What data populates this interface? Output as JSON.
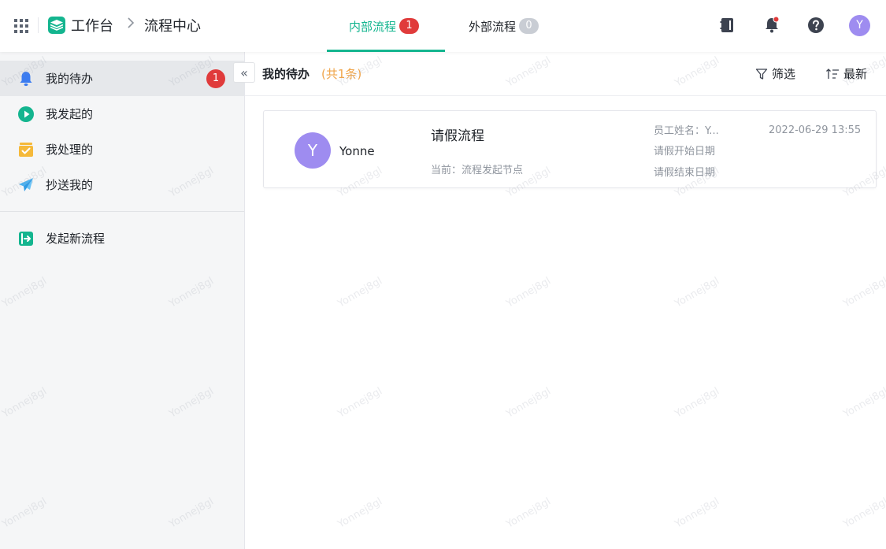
{
  "header": {
    "brand": "工作台",
    "breadcrumb_sep": ">",
    "breadcrumb_current": "流程中心",
    "tabs": [
      {
        "label": "内部流程",
        "count": "1",
        "active": true
      },
      {
        "label": "外部流程",
        "count": "0",
        "active": false
      }
    ],
    "icons": [
      "apps-grid-icon",
      "workbench-logo-icon",
      "address-book-icon",
      "notification-bell-icon",
      "help-icon"
    ],
    "user_initial": "Y",
    "accent_color": "#14b58f"
  },
  "sidebar": {
    "items": [
      {
        "label": "我的待办",
        "badge": "1",
        "icon": "bell-icon"
      },
      {
        "label": "我发起的",
        "icon": "play-circle-icon"
      },
      {
        "label": "我处理的",
        "icon": "check-box-icon"
      },
      {
        "label": "抄送我的",
        "icon": "paper-plane-icon"
      },
      {
        "label": "发起新流程",
        "icon": "enter-icon"
      }
    ],
    "collapse_glyph": "«"
  },
  "main": {
    "title": "我的待办",
    "count_text": "(共1条)",
    "filter_label": "筛选",
    "sort_label": "最新",
    "cards": [
      {
        "avatar": "Y",
        "user": "Yonne",
        "title": "请假流程",
        "node": "当前：流程发起节点",
        "fields": [
          "员工姓名：Y...",
          "请假开始日期",
          "请假结束日期"
        ],
        "time": "2022-06-29 13:55"
      }
    ]
  },
  "watermark": "Yonnej8gl"
}
